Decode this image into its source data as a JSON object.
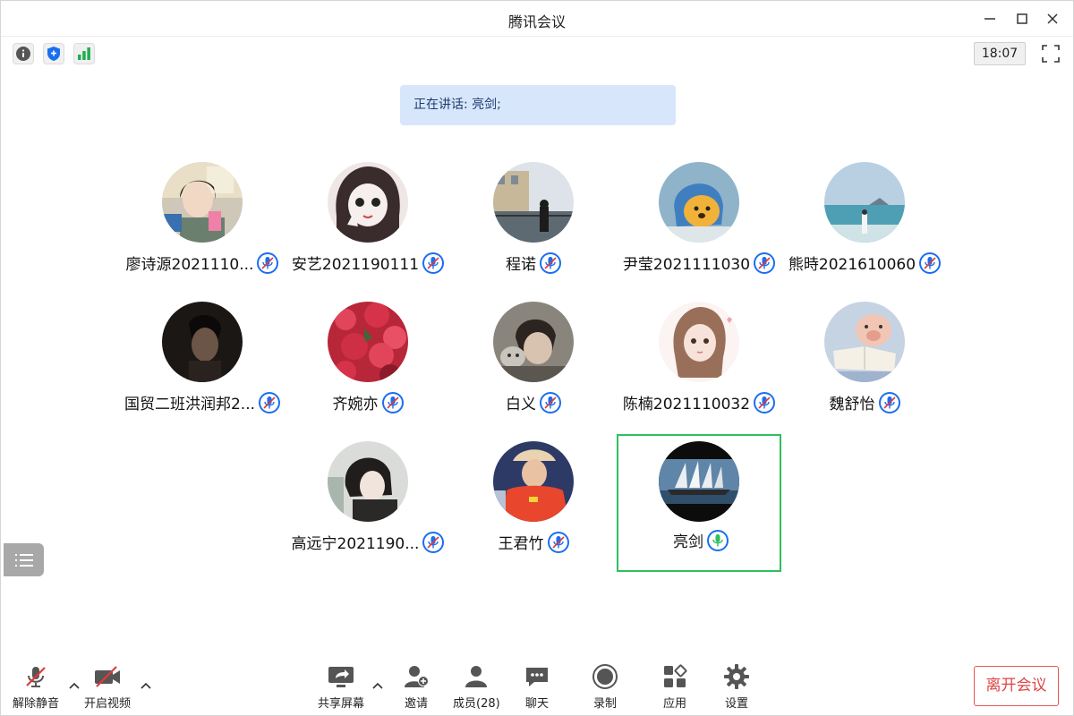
{
  "window": {
    "title": "腾讯会议"
  },
  "status": {
    "time": "18:07"
  },
  "speaking": {
    "text": "正在讲话: 亮剑;"
  },
  "participants": [
    {
      "name": "廖诗源2021110...",
      "mic": "muted"
    },
    {
      "name": "安艺2021190111",
      "mic": "muted"
    },
    {
      "name": "程诺",
      "mic": "muted"
    },
    {
      "name": "尹莹2021111030",
      "mic": "muted"
    },
    {
      "name": "熊時2021610060",
      "mic": "muted"
    },
    {
      "name": "国贸二班洪润邦2...",
      "mic": "muted"
    },
    {
      "name": "齐婉亦",
      "mic": "muted"
    },
    {
      "name": "白义",
      "mic": "muted"
    },
    {
      "name": "陈楠2021110032",
      "mic": "muted"
    },
    {
      "name": "魏舒怡",
      "mic": "muted"
    },
    {
      "name": "高远宁2021190...",
      "mic": "muted"
    },
    {
      "name": "王君竹",
      "mic": "muted"
    },
    {
      "name": "亮剑",
      "mic": "active"
    }
  ],
  "toolbar": {
    "unmute": "解除静音",
    "video": "开启视频",
    "share": "共享屏幕",
    "invite": "邀请",
    "members": "成员(28)",
    "chat": "聊天",
    "record": "录制",
    "apps": "应用",
    "settings": "设置",
    "leave": "离开会议"
  },
  "colors": {
    "accent": "#1a6ef0",
    "active_border": "#2fbf5f",
    "leave": "#e04444",
    "banner": "#d7e6fb"
  }
}
